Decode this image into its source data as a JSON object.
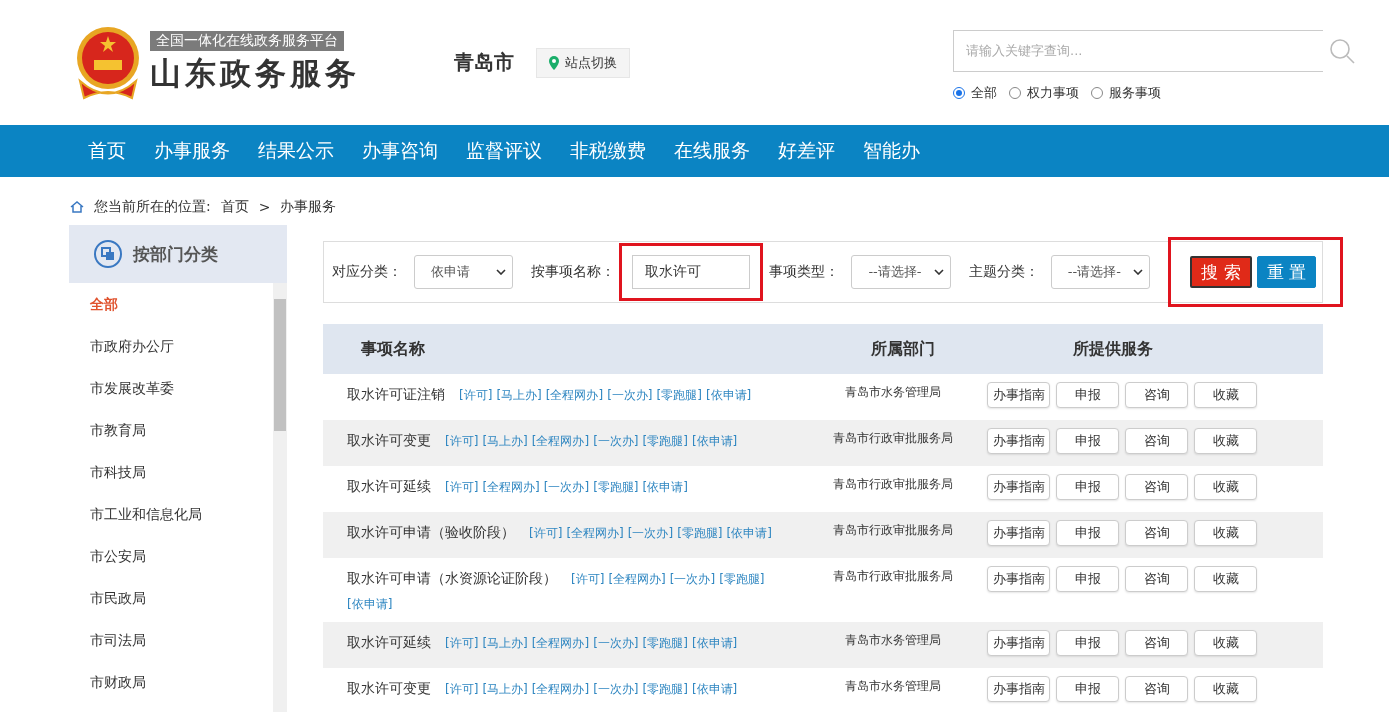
{
  "header": {
    "platform_tagline": "全国一体化在线政务服务平台",
    "site_title": "山东政务服务",
    "city": "青岛市",
    "switch_site": "站点切换",
    "search": {
      "placeholder": "请输入关键字查询..."
    },
    "scope_options": [
      {
        "label": "全部",
        "selected": true
      },
      {
        "label": "权力事项",
        "selected": false
      },
      {
        "label": "服务事项",
        "selected": false
      }
    ]
  },
  "nav": [
    {
      "label": "首页"
    },
    {
      "label": "办事服务"
    },
    {
      "label": "结果公示"
    },
    {
      "label": "办事咨询"
    },
    {
      "label": "监督评议"
    },
    {
      "label": "非税缴费"
    },
    {
      "label": "在线服务"
    },
    {
      "label": "好差评"
    },
    {
      "label": "智能办"
    }
  ],
  "breadcrumb": {
    "prefix": "您当前所在的位置:",
    "items": [
      "首页",
      "办事服务"
    ],
    "separator": ">"
  },
  "sidebar": {
    "title": "按部门分类",
    "items": [
      {
        "label": "全部",
        "selected": true
      },
      {
        "label": "市政府办公厅",
        "selected": false
      },
      {
        "label": "市发展改革委",
        "selected": false
      },
      {
        "label": "市教育局",
        "selected": false
      },
      {
        "label": "市科技局",
        "selected": false
      },
      {
        "label": "市工业和信息化局",
        "selected": false
      },
      {
        "label": "市公安局",
        "selected": false
      },
      {
        "label": "市民政局",
        "selected": false
      },
      {
        "label": "市司法局",
        "selected": false
      },
      {
        "label": "市财政局",
        "selected": false
      }
    ]
  },
  "filters": [
    {
      "kind": "select",
      "label": "对应分类：",
      "value": "依申请"
    },
    {
      "kind": "input",
      "label": "按事项名称：",
      "value": "取水许可",
      "highlighted": true
    },
    {
      "kind": "select",
      "label": "事项类型：",
      "value": "--请选择-"
    },
    {
      "kind": "select",
      "label": "主题分类：",
      "value": "--请选择-"
    }
  ],
  "filter_buttons": [
    {
      "kind": "search",
      "label": "搜 索"
    },
    {
      "kind": "reset",
      "label": "重 置"
    }
  ],
  "buttons_highlighted": true,
  "table": {
    "columns": [
      "事项名称",
      "所属部门",
      "所提供服务"
    ],
    "rows": [
      {
        "name": "取水许可证注销",
        "tags": [
          "[许可]",
          "[马上办]",
          "[全程网办]",
          "[一次办]",
          "[零跑腿]",
          "[依申请]"
        ],
        "department": "青岛市水务管理局",
        "actions": [
          "办事指南",
          "申报",
          "咨询",
          "收藏"
        ]
      },
      {
        "name": "取水许可变更",
        "tags": [
          "[许可]",
          "[马上办]",
          "[全程网办]",
          "[一次办]",
          "[零跑腿]",
          "[依申请]"
        ],
        "department": "青岛市行政审批服务局",
        "actions": [
          "办事指南",
          "申报",
          "咨询",
          "收藏"
        ]
      },
      {
        "name": "取水许可延续",
        "tags": [
          "[许可]",
          "[全程网办]",
          "[一次办]",
          "[零跑腿]",
          "[依申请]"
        ],
        "department": "青岛市行政审批服务局",
        "actions": [
          "办事指南",
          "申报",
          "咨询",
          "收藏"
        ]
      },
      {
        "name": "取水许可申请（验收阶段）",
        "tags": [
          "[许可]",
          "[全程网办]",
          "[一次办]",
          "[零跑腿]",
          "[依申请]"
        ],
        "department": "青岛市行政审批服务局",
        "actions": [
          "办事指南",
          "申报",
          "咨询",
          "收藏"
        ]
      },
      {
        "name": "取水许可申请（水资源论证阶段）",
        "tags": [
          "[许可]",
          "[全程网办]",
          "[一次办]",
          "[零跑腿]",
          "[依申请]"
        ],
        "department": "青岛市行政审批服务局",
        "actions": [
          "办事指南",
          "申报",
          "咨询",
          "收藏"
        ]
      },
      {
        "name": "取水许可延续",
        "tags": [
          "[许可]",
          "[马上办]",
          "[全程网办]",
          "[一次办]",
          "[零跑腿]",
          "[依申请]"
        ],
        "department": "青岛市水务管理局",
        "actions": [
          "办事指南",
          "申报",
          "咨询",
          "收藏"
        ]
      },
      {
        "name": "取水许可变更",
        "tags": [
          "[许可]",
          "[马上办]",
          "[全程网办]",
          "[一次办]",
          "[零跑腿]",
          "[依申请]"
        ],
        "department": "青岛市水务管理局",
        "actions": [
          "办事指南",
          "申报",
          "咨询",
          "收藏"
        ]
      }
    ]
  }
}
